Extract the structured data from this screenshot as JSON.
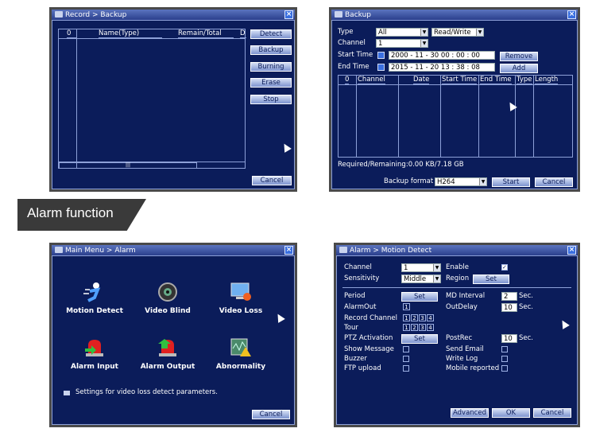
{
  "record_backup": {
    "title": "Record > Backup",
    "headers": [
      "0",
      "Name(Type)",
      "Remain/Total",
      "D"
    ],
    "buttons": [
      "Detect",
      "Backup",
      "Burning",
      "Erase",
      "Stop"
    ],
    "scroll_label": "|||",
    "cancel": "Cancel"
  },
  "backup": {
    "title": "Backup",
    "type_label": "Type",
    "type_value": "All",
    "mode_value": "Read/Write",
    "channel_label": "Channel",
    "channel_value": "1",
    "start_label": "Start Time",
    "start_value": "2000 - 11 - 30   00 : 00 : 00",
    "end_label": "End Time",
    "end_value": "2015 - 11 - 20   13 : 38 : 08",
    "remove": "Remove",
    "add": "Add",
    "headers": [
      "0",
      "Channel",
      "Date",
      "Start Time",
      "End Time",
      "Type",
      "Length"
    ],
    "required": "Required/Remaining:0.00 KB/7.18 GB",
    "format_label": "Backup format",
    "format_value": "H264",
    "start_btn": "Start",
    "cancel": "Cancel"
  },
  "banner": {
    "text": "Alarm function"
  },
  "alarm": {
    "title": "Main Menu > Alarm",
    "items": [
      "Motion Detect",
      "Video Blind",
      "Video Loss",
      "Alarm Input",
      "Alarm Output",
      "Abnormality"
    ],
    "status": "Settings for video loss detect parameters.",
    "cancel": "Cancel"
  },
  "motion": {
    "title": "Alarm > Motion Detect",
    "channel_label": "Channel",
    "channel_value": "1",
    "enable_label": "Enable",
    "sensitivity_label": "Sensitivity",
    "sensitivity_value": "Middle",
    "region_label": "Region",
    "set": "Set",
    "period_label": "Period",
    "md_interval_label": "MD Interval",
    "md_interval_value": "2",
    "sec": "Sec.",
    "alarmout_label": "AlarmOut",
    "outdelay_label": "OutDelay",
    "outdelay_value": "10",
    "record_channel_label": "Record Channel",
    "tour_label": "Tour",
    "ptz_label": "PTZ Activation",
    "postrec_label": "PostRec",
    "postrec_value": "10",
    "show_message_label": "Show Message",
    "send_email_label": "Send Email",
    "buzzer_label": "Buzzer",
    "write_log_label": "Write Log",
    "ftp_label": "FTP upload",
    "mobile_label": "Mobile reported",
    "nums": [
      "1",
      "2",
      "3",
      "4"
    ],
    "one": "1",
    "advanced": "Advanced",
    "ok": "OK",
    "cancel": "Cancel"
  }
}
